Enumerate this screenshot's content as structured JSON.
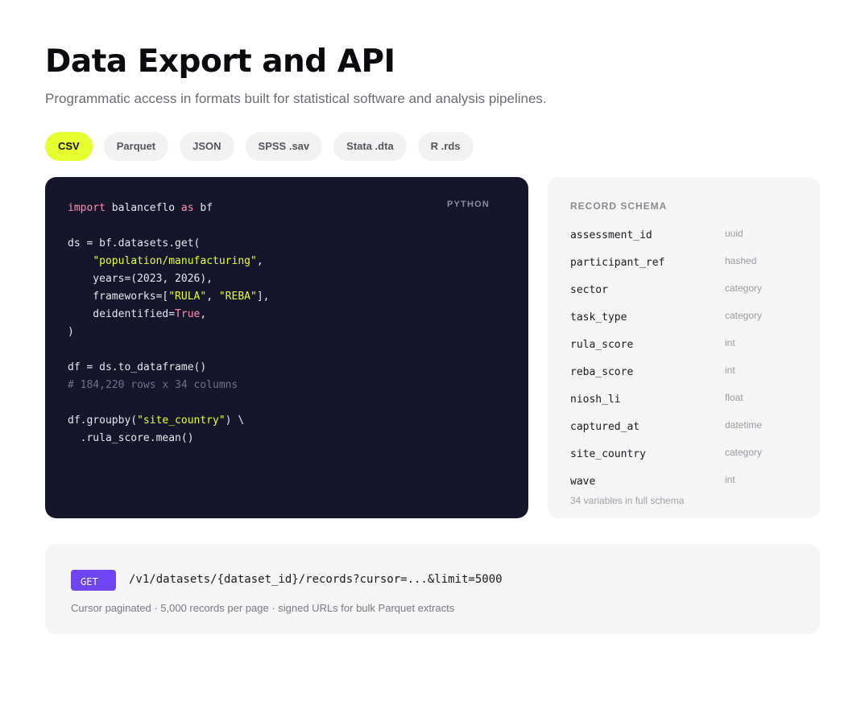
{
  "header": {
    "title": "Data Export and API",
    "subtitle": "Programmatic access in formats built for statistical software and analysis pipelines."
  },
  "formats": {
    "selected": "CSV",
    "tabs": [
      {
        "label": "CSV"
      },
      {
        "label": "Parquet"
      },
      {
        "label": "JSON"
      },
      {
        "label": "SPSS .sav"
      },
      {
        "label": "Stata .dta"
      },
      {
        "label": "R .rds"
      }
    ]
  },
  "code": {
    "language": "PYTHON",
    "lines": [
      [
        {
          "t": "import",
          "c": "kw"
        },
        {
          "t": " balanceflo "
        },
        {
          "t": "as",
          "c": "kw"
        },
        {
          "t": " bf"
        }
      ],
      [],
      [
        {
          "t": "ds = bf.datasets.get("
        }
      ],
      [
        {
          "t": "    "
        },
        {
          "t": "\"population/manufacturing\"",
          "c": "str"
        },
        {
          "t": ","
        }
      ],
      [
        {
          "t": "    years=(2023, 2026),"
        }
      ],
      [
        {
          "t": "    frameworks=["
        },
        {
          "t": "\"RULA\"",
          "c": "str"
        },
        {
          "t": ", "
        },
        {
          "t": "\"REBA\"",
          "c": "str"
        },
        {
          "t": "],"
        }
      ],
      [
        {
          "t": "    deidentified="
        },
        {
          "t": "True",
          "c": "bool"
        },
        {
          "t": ","
        }
      ],
      [
        {
          "t": ")"
        }
      ],
      [],
      [
        {
          "t": "df = ds.to_dataframe()"
        }
      ],
      [
        {
          "t": "# 184,220 rows x 34 columns",
          "c": "comment"
        }
      ],
      [],
      [
        {
          "t": "df.groupby("
        },
        {
          "t": "\"site_country\"",
          "c": "str"
        },
        {
          "t": ") \\"
        }
      ],
      [
        {
          "t": "  .rula_score.mean()"
        }
      ]
    ]
  },
  "schema": {
    "heading": "RECORD SCHEMA",
    "fields": [
      {
        "name": "assessment_id",
        "type": "uuid"
      },
      {
        "name": "participant_ref",
        "type": "hashed"
      },
      {
        "name": "sector",
        "type": "category"
      },
      {
        "name": "task_type",
        "type": "category"
      },
      {
        "name": "rula_score",
        "type": "int"
      },
      {
        "name": "reba_score",
        "type": "int"
      },
      {
        "name": "niosh_li",
        "type": "float"
      },
      {
        "name": "captured_at",
        "type": "datetime"
      },
      {
        "name": "site_country",
        "type": "category"
      },
      {
        "name": "wave",
        "type": "int"
      }
    ],
    "footnote": "34 variables in full schema"
  },
  "api": {
    "method": "GET",
    "path": "/v1/datasets/{dataset_id}/records?cursor=...&limit=5000",
    "note": "Cursor paginated · 5,000 records per page · signed URLs for bulk Parquet extracts"
  }
}
